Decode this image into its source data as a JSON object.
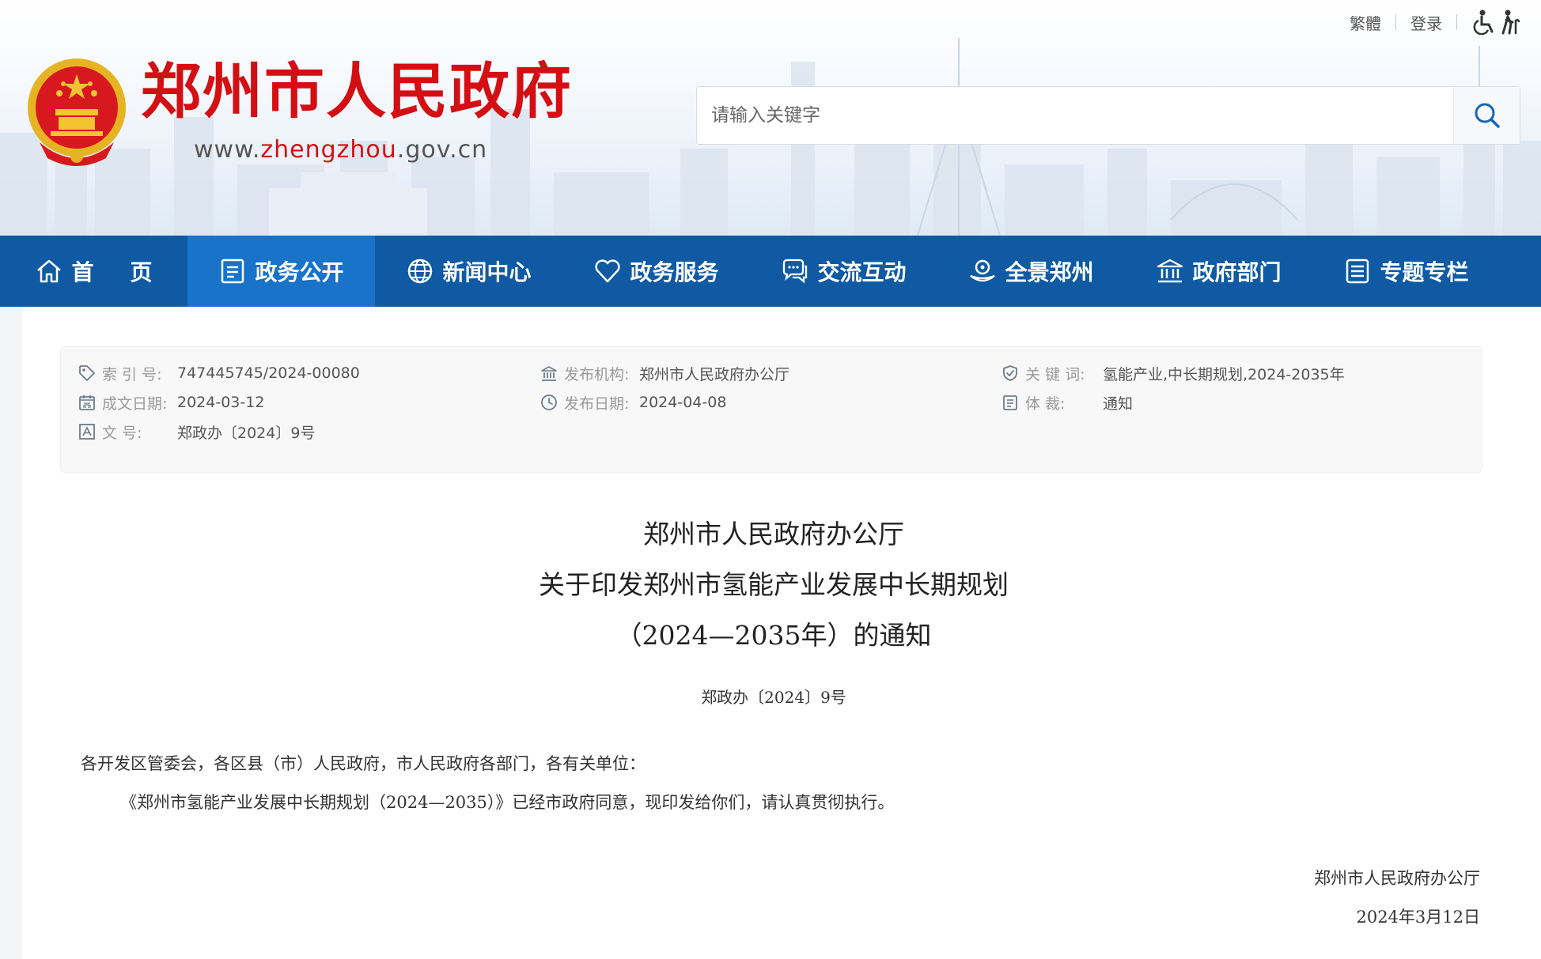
{
  "header": {
    "site_title": "郑州市人民政府",
    "url_prefix": "www.",
    "url_mid": "zhengzhou",
    "url_suffix": ".gov.cn",
    "top_links": {
      "traditional": "繁體",
      "login": "登录"
    },
    "search": {
      "placeholder": "请输入关键字"
    }
  },
  "nav": {
    "items": [
      {
        "label": "首页",
        "icon": "home-icon"
      },
      {
        "label": "政务公开",
        "icon": "document-board-icon",
        "active": true
      },
      {
        "label": "新闻中心",
        "icon": "globe-icon"
      },
      {
        "label": "政务服务",
        "icon": "heart-icon"
      },
      {
        "label": "交流互动",
        "icon": "chat-icon"
      },
      {
        "label": "全景郑州",
        "icon": "panorama-icon"
      },
      {
        "label": "政府部门",
        "icon": "government-building-icon"
      },
      {
        "label": "专题专栏",
        "icon": "list-icon"
      }
    ]
  },
  "meta": {
    "index_label": "索  引  号:",
    "index_value": "747445745/2024-00080",
    "written_date_label": "成文日期:",
    "written_date_value": "2024-03-12",
    "doc_no_label": "文        号:",
    "doc_no_value": "郑政办〔2024〕9号",
    "publisher_label": "发布机构:",
    "publisher_value": "郑州市人民政府办公厅",
    "publish_date_label": "发布日期:",
    "publish_date_value": "2024-04-08",
    "keywords_label": "关  键  词:",
    "keywords_value": "氢能产业,中长期规划,2024-2035年",
    "genre_label": "体        裁:",
    "genre_value": "通知"
  },
  "document": {
    "title_line1": "郑州市人民政府办公厅",
    "title_line2": "关于印发郑州市氢能产业发展中长期规划",
    "title_line3": "（2024—2035年）的通知",
    "number": "郑政办〔2024〕9号",
    "salutation": "各开发区管委会，各区县（市）人民政府，市人民政府各部门，各有关单位：",
    "paragraph": "《郑州市氢能产业发展中长期规划（2024—2035）》已经市政府同意，现印发给你们，请认真贯彻执行。",
    "signer": "郑州市人民政府办公厅",
    "date": "2024年3月12日"
  },
  "colors": {
    "nav_bg": "#0f5aa3",
    "nav_active": "#1873c9",
    "title_red": "#d40f14"
  }
}
